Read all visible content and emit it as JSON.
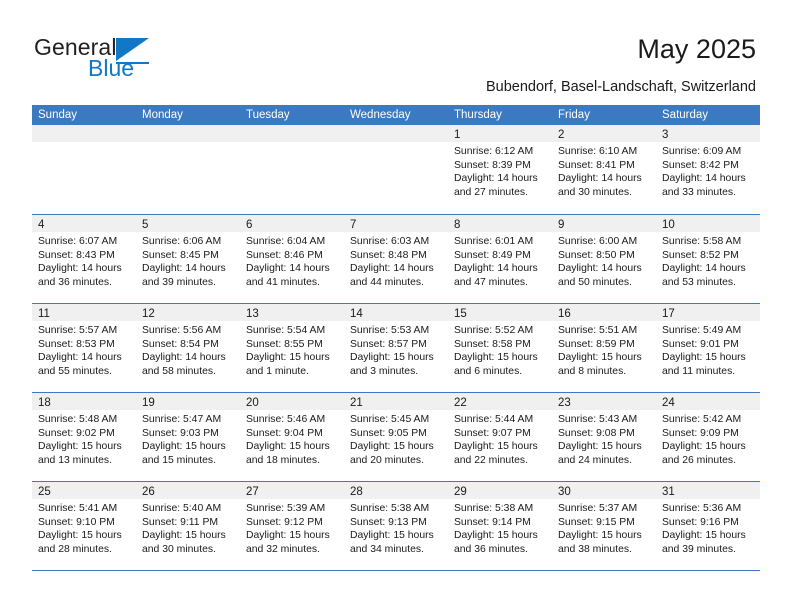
{
  "brand": {
    "name_part1": "General",
    "name_part2": "Blue",
    "accent_color": "#1277c4"
  },
  "header": {
    "title": "May 2025",
    "subtitle": "Bubendorf, Basel-Landschaft, Switzerland",
    "header_bar_color": "#3b79c0",
    "date_band_color": "#f0f0f0"
  },
  "weekdays": [
    "Sunday",
    "Monday",
    "Tuesday",
    "Wednesday",
    "Thursday",
    "Friday",
    "Saturday"
  ],
  "weeks": [
    [
      {
        "day": "",
        "sunrise": "",
        "sunset": "",
        "daylight_line1": "",
        "daylight_line2": ""
      },
      {
        "day": "",
        "sunrise": "",
        "sunset": "",
        "daylight_line1": "",
        "daylight_line2": ""
      },
      {
        "day": "",
        "sunrise": "",
        "sunset": "",
        "daylight_line1": "",
        "daylight_line2": ""
      },
      {
        "day": "",
        "sunrise": "",
        "sunset": "",
        "daylight_line1": "",
        "daylight_line2": ""
      },
      {
        "day": "1",
        "sunrise": "Sunrise: 6:12 AM",
        "sunset": "Sunset: 8:39 PM",
        "daylight_line1": "Daylight: 14 hours",
        "daylight_line2": "and 27 minutes."
      },
      {
        "day": "2",
        "sunrise": "Sunrise: 6:10 AM",
        "sunset": "Sunset: 8:41 PM",
        "daylight_line1": "Daylight: 14 hours",
        "daylight_line2": "and 30 minutes."
      },
      {
        "day": "3",
        "sunrise": "Sunrise: 6:09 AM",
        "sunset": "Sunset: 8:42 PM",
        "daylight_line1": "Daylight: 14 hours",
        "daylight_line2": "and 33 minutes."
      }
    ],
    [
      {
        "day": "4",
        "sunrise": "Sunrise: 6:07 AM",
        "sunset": "Sunset: 8:43 PM",
        "daylight_line1": "Daylight: 14 hours",
        "daylight_line2": "and 36 minutes."
      },
      {
        "day": "5",
        "sunrise": "Sunrise: 6:06 AM",
        "sunset": "Sunset: 8:45 PM",
        "daylight_line1": "Daylight: 14 hours",
        "daylight_line2": "and 39 minutes."
      },
      {
        "day": "6",
        "sunrise": "Sunrise: 6:04 AM",
        "sunset": "Sunset: 8:46 PM",
        "daylight_line1": "Daylight: 14 hours",
        "daylight_line2": "and 41 minutes."
      },
      {
        "day": "7",
        "sunrise": "Sunrise: 6:03 AM",
        "sunset": "Sunset: 8:48 PM",
        "daylight_line1": "Daylight: 14 hours",
        "daylight_line2": "and 44 minutes."
      },
      {
        "day": "8",
        "sunrise": "Sunrise: 6:01 AM",
        "sunset": "Sunset: 8:49 PM",
        "daylight_line1": "Daylight: 14 hours",
        "daylight_line2": "and 47 minutes."
      },
      {
        "day": "9",
        "sunrise": "Sunrise: 6:00 AM",
        "sunset": "Sunset: 8:50 PM",
        "daylight_line1": "Daylight: 14 hours",
        "daylight_line2": "and 50 minutes."
      },
      {
        "day": "10",
        "sunrise": "Sunrise: 5:58 AM",
        "sunset": "Sunset: 8:52 PM",
        "daylight_line1": "Daylight: 14 hours",
        "daylight_line2": "and 53 minutes."
      }
    ],
    [
      {
        "day": "11",
        "sunrise": "Sunrise: 5:57 AM",
        "sunset": "Sunset: 8:53 PM",
        "daylight_line1": "Daylight: 14 hours",
        "daylight_line2": "and 55 minutes."
      },
      {
        "day": "12",
        "sunrise": "Sunrise: 5:56 AM",
        "sunset": "Sunset: 8:54 PM",
        "daylight_line1": "Daylight: 14 hours",
        "daylight_line2": "and 58 minutes."
      },
      {
        "day": "13",
        "sunrise": "Sunrise: 5:54 AM",
        "sunset": "Sunset: 8:55 PM",
        "daylight_line1": "Daylight: 15 hours",
        "daylight_line2": "and 1 minute."
      },
      {
        "day": "14",
        "sunrise": "Sunrise: 5:53 AM",
        "sunset": "Sunset: 8:57 PM",
        "daylight_line1": "Daylight: 15 hours",
        "daylight_line2": "and 3 minutes."
      },
      {
        "day": "15",
        "sunrise": "Sunrise: 5:52 AM",
        "sunset": "Sunset: 8:58 PM",
        "daylight_line1": "Daylight: 15 hours",
        "daylight_line2": "and 6 minutes."
      },
      {
        "day": "16",
        "sunrise": "Sunrise: 5:51 AM",
        "sunset": "Sunset: 8:59 PM",
        "daylight_line1": "Daylight: 15 hours",
        "daylight_line2": "and 8 minutes."
      },
      {
        "day": "17",
        "sunrise": "Sunrise: 5:49 AM",
        "sunset": "Sunset: 9:01 PM",
        "daylight_line1": "Daylight: 15 hours",
        "daylight_line2": "and 11 minutes."
      }
    ],
    [
      {
        "day": "18",
        "sunrise": "Sunrise: 5:48 AM",
        "sunset": "Sunset: 9:02 PM",
        "daylight_line1": "Daylight: 15 hours",
        "daylight_line2": "and 13 minutes."
      },
      {
        "day": "19",
        "sunrise": "Sunrise: 5:47 AM",
        "sunset": "Sunset: 9:03 PM",
        "daylight_line1": "Daylight: 15 hours",
        "daylight_line2": "and 15 minutes."
      },
      {
        "day": "20",
        "sunrise": "Sunrise: 5:46 AM",
        "sunset": "Sunset: 9:04 PM",
        "daylight_line1": "Daylight: 15 hours",
        "daylight_line2": "and 18 minutes."
      },
      {
        "day": "21",
        "sunrise": "Sunrise: 5:45 AM",
        "sunset": "Sunset: 9:05 PM",
        "daylight_line1": "Daylight: 15 hours",
        "daylight_line2": "and 20 minutes."
      },
      {
        "day": "22",
        "sunrise": "Sunrise: 5:44 AM",
        "sunset": "Sunset: 9:07 PM",
        "daylight_line1": "Daylight: 15 hours",
        "daylight_line2": "and 22 minutes."
      },
      {
        "day": "23",
        "sunrise": "Sunrise: 5:43 AM",
        "sunset": "Sunset: 9:08 PM",
        "daylight_line1": "Daylight: 15 hours",
        "daylight_line2": "and 24 minutes."
      },
      {
        "day": "24",
        "sunrise": "Sunrise: 5:42 AM",
        "sunset": "Sunset: 9:09 PM",
        "daylight_line1": "Daylight: 15 hours",
        "daylight_line2": "and 26 minutes."
      }
    ],
    [
      {
        "day": "25",
        "sunrise": "Sunrise: 5:41 AM",
        "sunset": "Sunset: 9:10 PM",
        "daylight_line1": "Daylight: 15 hours",
        "daylight_line2": "and 28 minutes."
      },
      {
        "day": "26",
        "sunrise": "Sunrise: 5:40 AM",
        "sunset": "Sunset: 9:11 PM",
        "daylight_line1": "Daylight: 15 hours",
        "daylight_line2": "and 30 minutes."
      },
      {
        "day": "27",
        "sunrise": "Sunrise: 5:39 AM",
        "sunset": "Sunset: 9:12 PM",
        "daylight_line1": "Daylight: 15 hours",
        "daylight_line2": "and 32 minutes."
      },
      {
        "day": "28",
        "sunrise": "Sunrise: 5:38 AM",
        "sunset": "Sunset: 9:13 PM",
        "daylight_line1": "Daylight: 15 hours",
        "daylight_line2": "and 34 minutes."
      },
      {
        "day": "29",
        "sunrise": "Sunrise: 5:38 AM",
        "sunset": "Sunset: 9:14 PM",
        "daylight_line1": "Daylight: 15 hours",
        "daylight_line2": "and 36 minutes."
      },
      {
        "day": "30",
        "sunrise": "Sunrise: 5:37 AM",
        "sunset": "Sunset: 9:15 PM",
        "daylight_line1": "Daylight: 15 hours",
        "daylight_line2": "and 38 minutes."
      },
      {
        "day": "31",
        "sunrise": "Sunrise: 5:36 AM",
        "sunset": "Sunset: 9:16 PM",
        "daylight_line1": "Daylight: 15 hours",
        "daylight_line2": "and 39 minutes."
      }
    ]
  ]
}
